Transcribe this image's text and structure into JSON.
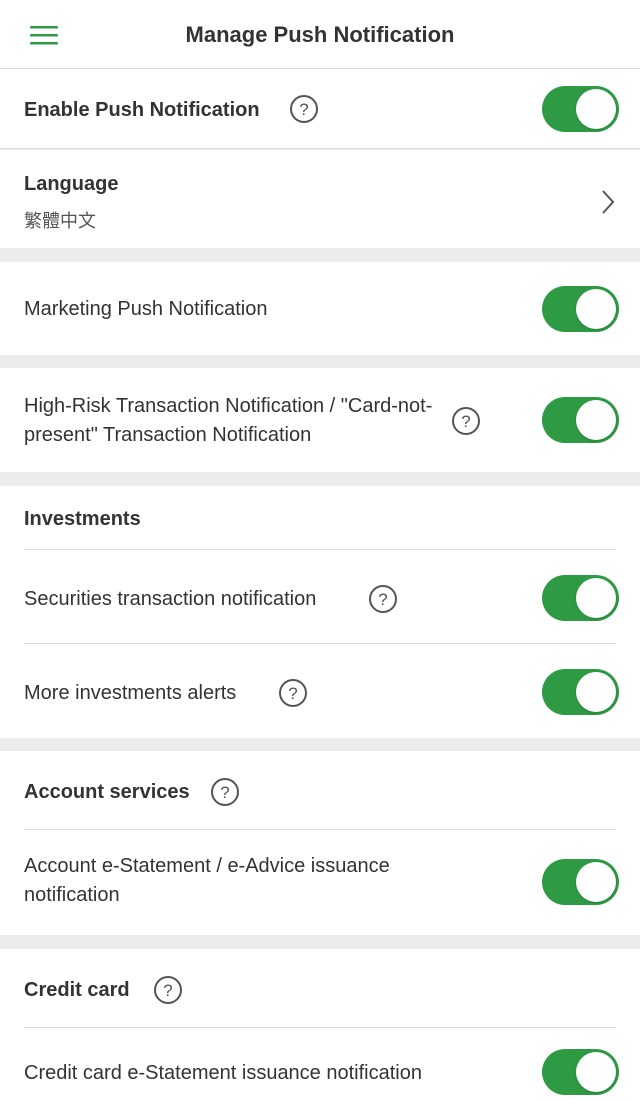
{
  "header": {
    "title": "Manage Push Notification",
    "menu_icon": "hamburger-menu-icon"
  },
  "enable_push": {
    "label": "Enable Push Notification",
    "enabled": true
  },
  "language": {
    "label": "Language",
    "value": "繁體中文"
  },
  "marketing": {
    "label": "Marketing Push Notification",
    "enabled": true
  },
  "high_risk": {
    "label": "High-Risk Transaction Notification / \"Card-not-present\" Transaction Notification",
    "enabled": true
  },
  "investments": {
    "title": "Investments",
    "securities_label": "Securities transaction notification",
    "securities_enabled": true,
    "more_alerts_label": "More investments alerts",
    "more_alerts_enabled": true
  },
  "account_services": {
    "title": "Account services",
    "estatement_label": "Account e-Statement / e-Advice issuance notification",
    "estatement_enabled": true
  },
  "credit_card": {
    "title": "Credit card",
    "estatement_label": "Credit card e-Statement issuance notification",
    "estatement_enabled": true
  },
  "colors": {
    "accent": "#2e9a44",
    "toggle_on": "#2e9a44",
    "divider": "#dcdcdc",
    "section_gap": "#ececec"
  }
}
